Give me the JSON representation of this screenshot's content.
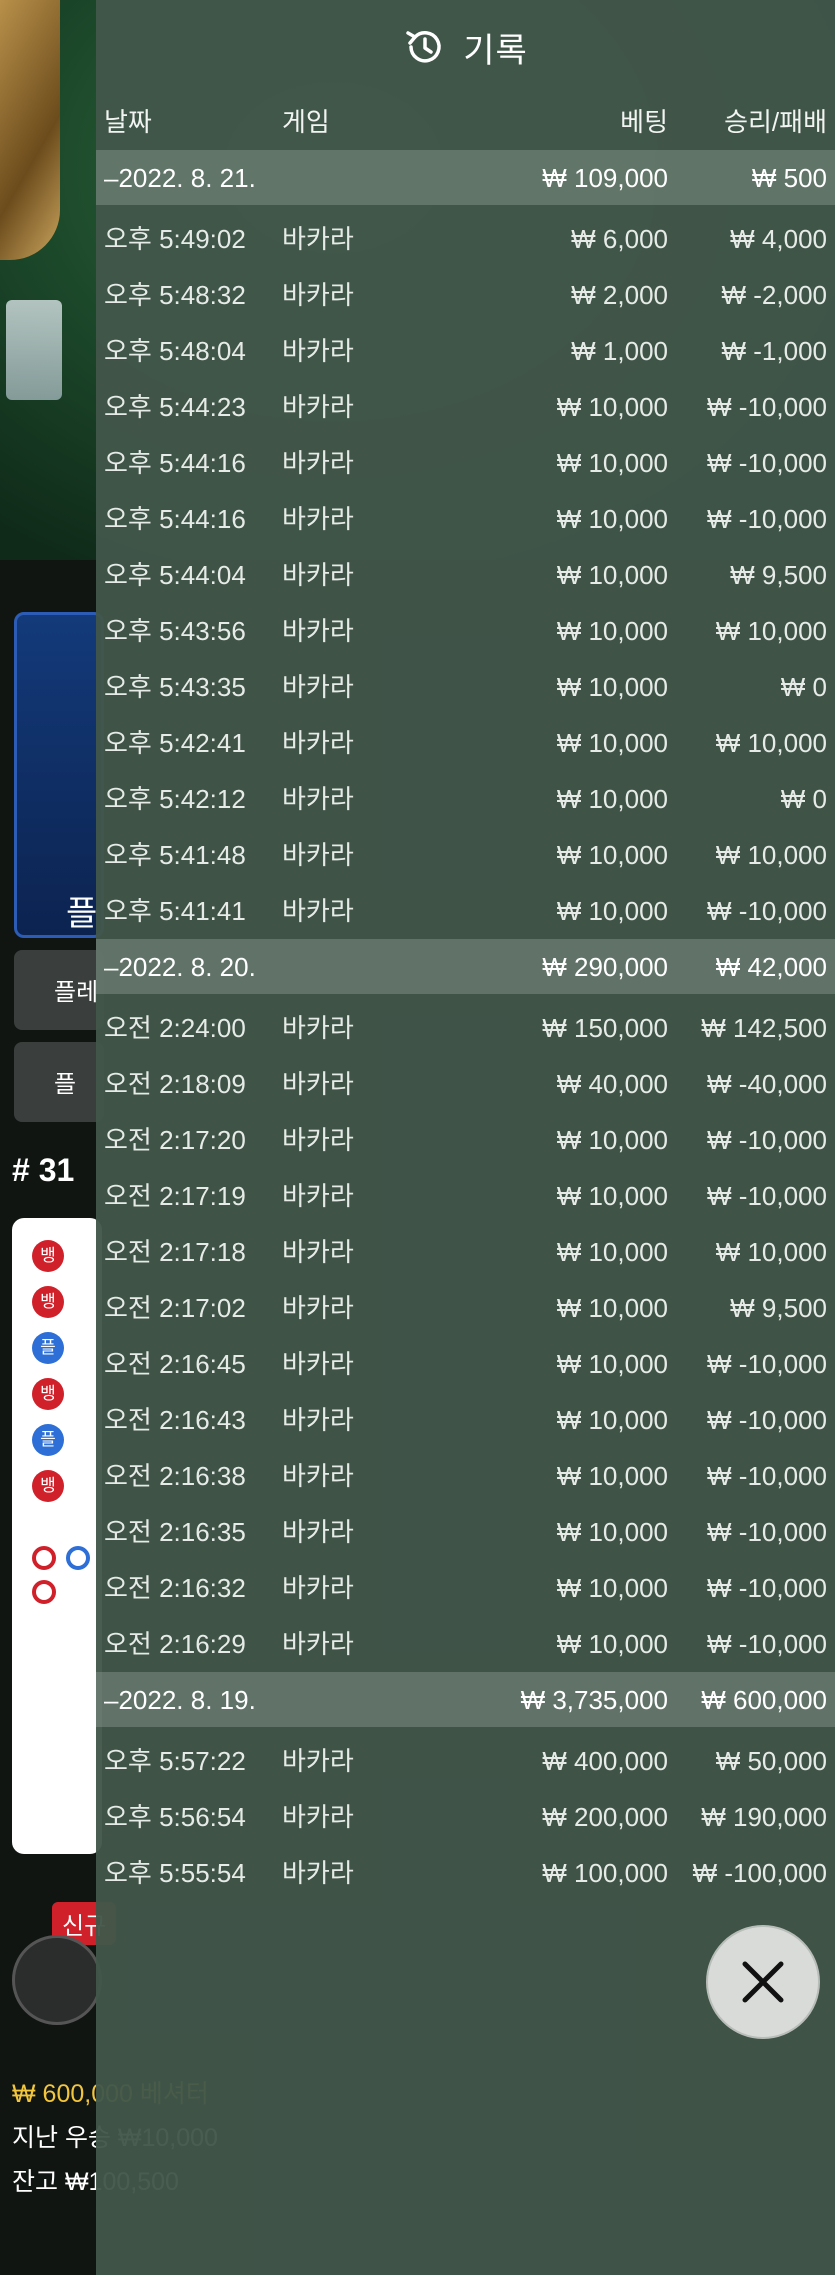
{
  "background": {
    "player_label": "플",
    "btn1_label": "플레",
    "btn2_label": "플",
    "round_label": "# 31",
    "road_dots": [
      {
        "text": "뱅",
        "color": "red"
      },
      {
        "text": "뱅",
        "color": "red"
      },
      {
        "text": "플",
        "color": "blue"
      },
      {
        "text": "뱅",
        "color": "red"
      },
      {
        "text": "플",
        "color": "blue"
      },
      {
        "text": "뱅",
        "color": "red"
      }
    ],
    "new_badge": "신규",
    "footer_bet": "₩ 600,000 베셔터",
    "footer_last_win": "지난 우승 ₩10,000",
    "footer_balance": "잔고 ₩100,500"
  },
  "history": {
    "title": "기록",
    "columns": {
      "date": "날짜",
      "game": "게임",
      "bet": "베팅",
      "win": "승리/패배"
    },
    "groups": [
      {
        "date": "–2022. 8. 21.",
        "total_bet": "₩ 109,000",
        "total_win": "₩ 500",
        "rows": [
          {
            "time": "오후 5:49:02",
            "game": "바카라",
            "bet": "₩ 6,000",
            "win": "₩ 4,000"
          },
          {
            "time": "오후 5:48:32",
            "game": "바카라",
            "bet": "₩ 2,000",
            "win": "₩ -2,000"
          },
          {
            "time": "오후 5:48:04",
            "game": "바카라",
            "bet": "₩ 1,000",
            "win": "₩ -1,000"
          },
          {
            "time": "오후 5:44:23",
            "game": "바카라",
            "bet": "₩ 10,000",
            "win": "₩ -10,000"
          },
          {
            "time": "오후 5:44:16",
            "game": "바카라",
            "bet": "₩ 10,000",
            "win": "₩ -10,000"
          },
          {
            "time": "오후 5:44:16",
            "game": "바카라",
            "bet": "₩ 10,000",
            "win": "₩ -10,000"
          },
          {
            "time": "오후 5:44:04",
            "game": "바카라",
            "bet": "₩ 10,000",
            "win": "₩ 9,500"
          },
          {
            "time": "오후 5:43:56",
            "game": "바카라",
            "bet": "₩ 10,000",
            "win": "₩ 10,000"
          },
          {
            "time": "오후 5:43:35",
            "game": "바카라",
            "bet": "₩ 10,000",
            "win": "₩ 0"
          },
          {
            "time": "오후 5:42:41",
            "game": "바카라",
            "bet": "₩ 10,000",
            "win": "₩ 10,000"
          },
          {
            "time": "오후 5:42:12",
            "game": "바카라",
            "bet": "₩ 10,000",
            "win": "₩ 0"
          },
          {
            "time": "오후 5:41:48",
            "game": "바카라",
            "bet": "₩ 10,000",
            "win": "₩ 10,000"
          },
          {
            "time": "오후 5:41:41",
            "game": "바카라",
            "bet": "₩ 10,000",
            "win": "₩ -10,000"
          }
        ]
      },
      {
        "date": "–2022. 8. 20.",
        "total_bet": "₩ 290,000",
        "total_win": "₩ 42,000",
        "rows": [
          {
            "time": "오전 2:24:00",
            "game": "바카라",
            "bet": "₩ 150,000",
            "win": "₩ 142,500"
          },
          {
            "time": "오전 2:18:09",
            "game": "바카라",
            "bet": "₩ 40,000",
            "win": "₩ -40,000"
          },
          {
            "time": "오전 2:17:20",
            "game": "바카라",
            "bet": "₩ 10,000",
            "win": "₩ -10,000"
          },
          {
            "time": "오전 2:17:19",
            "game": "바카라",
            "bet": "₩ 10,000",
            "win": "₩ -10,000"
          },
          {
            "time": "오전 2:17:18",
            "game": "바카라",
            "bet": "₩ 10,000",
            "win": "₩ 10,000"
          },
          {
            "time": "오전 2:17:02",
            "game": "바카라",
            "bet": "₩ 10,000",
            "win": "₩ 9,500"
          },
          {
            "time": "오전 2:16:45",
            "game": "바카라",
            "bet": "₩ 10,000",
            "win": "₩ -10,000"
          },
          {
            "time": "오전 2:16:43",
            "game": "바카라",
            "bet": "₩ 10,000",
            "win": "₩ -10,000"
          },
          {
            "time": "오전 2:16:38",
            "game": "바카라",
            "bet": "₩ 10,000",
            "win": "₩ -10,000"
          },
          {
            "time": "오전 2:16:35",
            "game": "바카라",
            "bet": "₩ 10,000",
            "win": "₩ -10,000"
          },
          {
            "time": "오전 2:16:32",
            "game": "바카라",
            "bet": "₩ 10,000",
            "win": "₩ -10,000"
          },
          {
            "time": "오전 2:16:29",
            "game": "바카라",
            "bet": "₩ 10,000",
            "win": "₩ -10,000"
          }
        ]
      },
      {
        "date": "–2022. 8. 19.",
        "total_bet": "₩ 3,735,000",
        "total_win": "₩ 600,000",
        "rows": [
          {
            "time": "오후 5:57:22",
            "game": "바카라",
            "bet": "₩ 400,000",
            "win": "₩ 50,000"
          },
          {
            "time": "오후 5:56:54",
            "game": "바카라",
            "bet": "₩ 200,000",
            "win": "₩ 190,000"
          },
          {
            "time": "오후 5:55:54",
            "game": "바카라",
            "bet": "₩ 100,000",
            "win": "₩ -100,000"
          }
        ]
      }
    ]
  }
}
